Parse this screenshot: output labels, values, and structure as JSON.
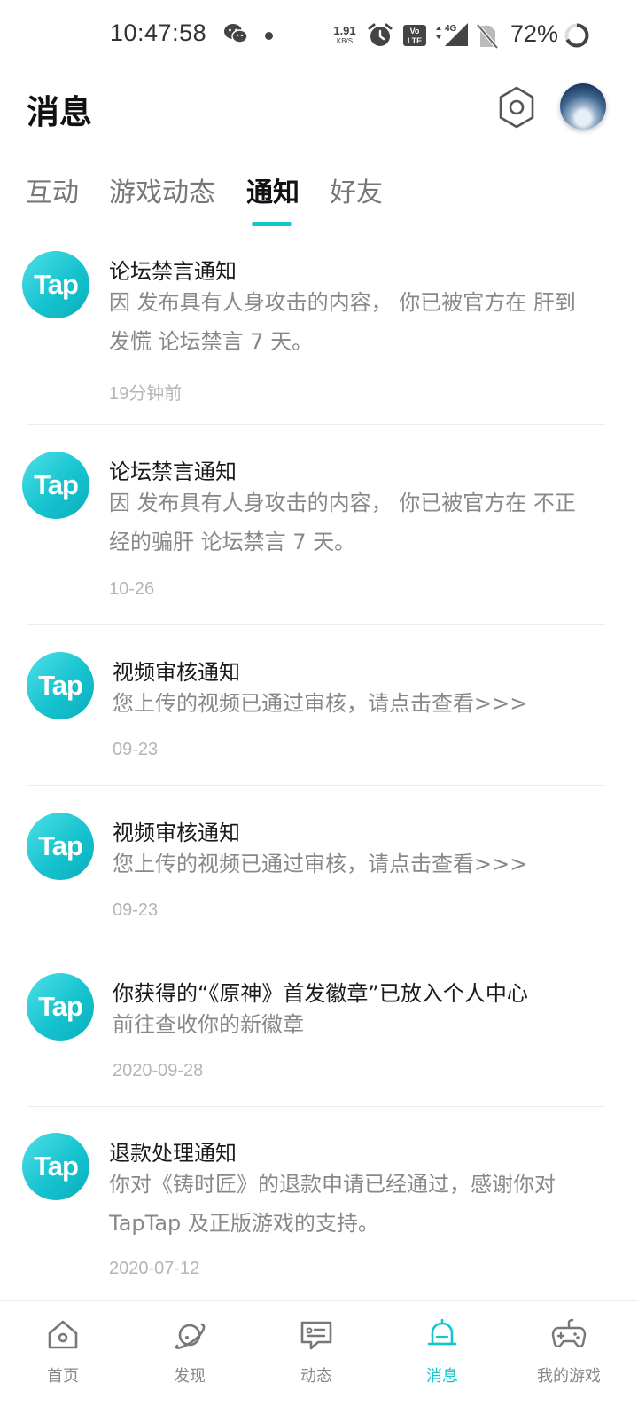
{
  "status_bar": {
    "time": "10:47:58",
    "net_speed_value": "1.91",
    "net_speed_unit": "KB/S",
    "network": "4G",
    "battery": "72%"
  },
  "header": {
    "title": "消息",
    "settings_icon": "settings-hexagon-icon"
  },
  "tabs": [
    {
      "label": "互动",
      "active": false
    },
    {
      "label": "游戏动态",
      "active": false
    },
    {
      "label": "通知",
      "active": true
    },
    {
      "label": "好友",
      "active": false
    }
  ],
  "notifications": [
    {
      "icon_text": "Tap",
      "title": "论坛禁言通知",
      "desc": "因 发布具有人身攻击的内容， 你已被官方在 肝到发慌 论坛禁言 7 天。",
      "time": "19分钟前"
    },
    {
      "icon_text": "Tap",
      "title": "论坛禁言通知",
      "desc": "因 发布具有人身攻击的内容， 你已被官方在 不正经的骗肝 论坛禁言 7 天。",
      "time": "10-26"
    },
    {
      "icon_text": "Tap",
      "title": "视频审核通知",
      "desc": "您上传的视频已通过审核，请点击查看>>>",
      "time": "09-23"
    },
    {
      "icon_text": "Tap",
      "title": "视频审核通知",
      "desc": "您上传的视频已通过审核，请点击查看>>>",
      "time": "09-23"
    },
    {
      "icon_text": "Tap",
      "title": "你获得的“《原神》首发徽章”已放入个人中心",
      "desc": "前往查收你的新徽章",
      "time": "2020-09-28"
    },
    {
      "icon_text": "Tap",
      "title": "退款处理通知",
      "desc": "你对《铸时匠》的退款申请已经通过，感谢你对 TapTap 及正版游戏的支持。",
      "time": "2020-07-12"
    }
  ],
  "bottom_nav": [
    {
      "label": "首页",
      "icon": "home-icon",
      "active": false
    },
    {
      "label": "发现",
      "icon": "planet-icon",
      "active": false
    },
    {
      "label": "动态",
      "icon": "chat-bubble-icon",
      "active": false
    },
    {
      "label": "消息",
      "icon": "bell-icon",
      "active": true
    },
    {
      "label": "我的游戏",
      "icon": "gamepad-icon",
      "active": false
    }
  ],
  "colors": {
    "accent": "#15c5ce",
    "text_primary": "#1a1a1a",
    "text_secondary": "#888888",
    "text_time": "#b5b5b5"
  }
}
